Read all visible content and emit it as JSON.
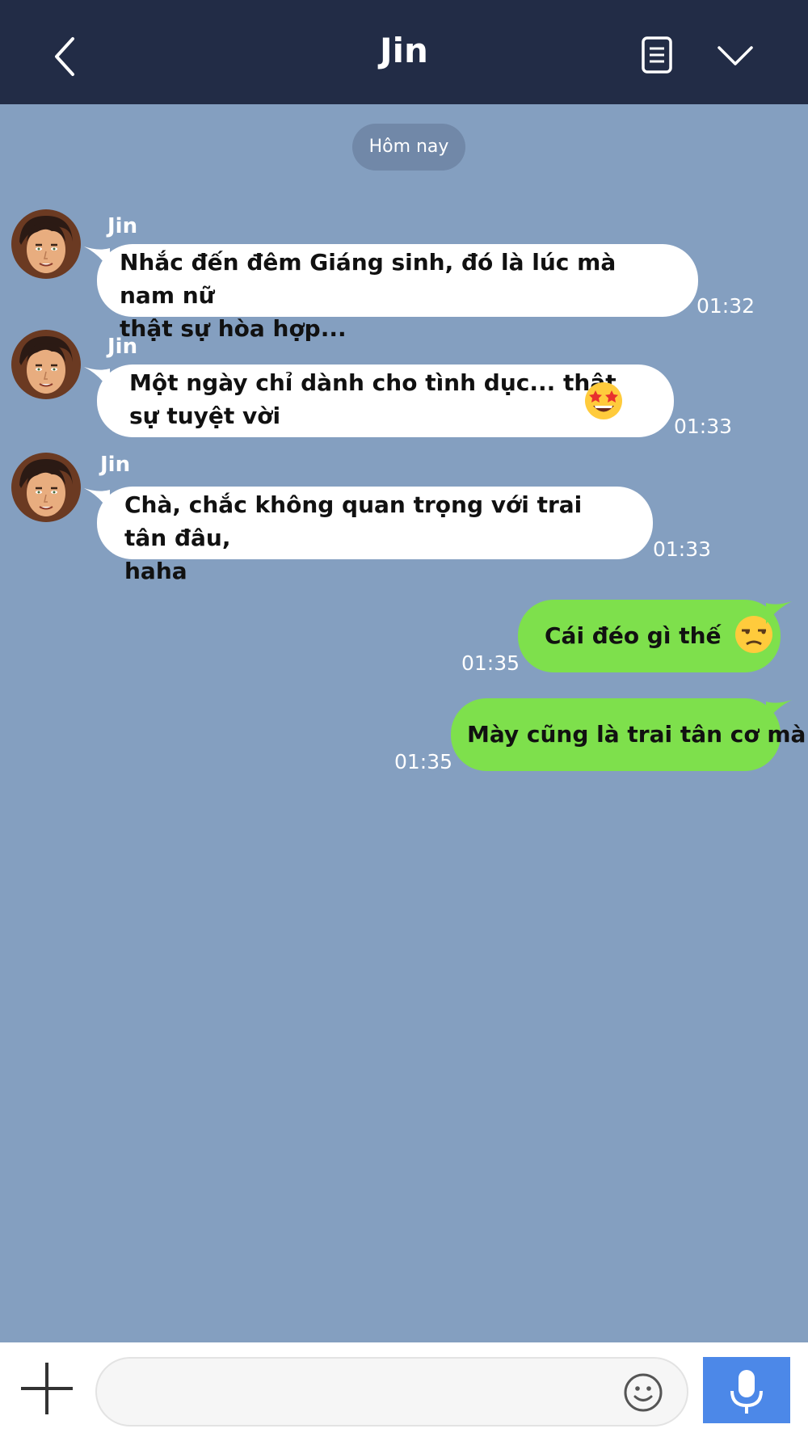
{
  "header": {
    "title": "Jin",
    "back_icon": "chevron-left-icon",
    "notes_icon": "notes-icon",
    "menu_icon": "chevron-down-icon",
    "background_color": "#222c46"
  },
  "chat": {
    "background_color": "#849fc0",
    "date_separator": "Hôm nay",
    "messages": [
      {
        "direction": "incoming",
        "sender": "Jin",
        "lines": [
          "Nhắc đến đêm Giáng sinh, đó là lúc mà nam nữ",
          "thật sự hòa hợp..."
        ],
        "time": "01:32"
      },
      {
        "direction": "incoming",
        "sender": "Jin",
        "lines": [
          "Một ngày chỉ dành cho tình dục... thật",
          "sự tuyệt vời"
        ],
        "emoji": "star-struck-emoji",
        "time": "01:33"
      },
      {
        "direction": "incoming",
        "sender": "Jin",
        "lines": [
          "Chà, chắc không quan trọng với trai tân đâu,",
          "haha"
        ],
        "time": "01:33"
      },
      {
        "direction": "outgoing",
        "text": "Cái đéo gì thế",
        "emoji": "unamused-emoji",
        "time": "01:35"
      },
      {
        "direction": "outgoing",
        "text": "Mày cũng là trai tân cơ mà",
        "time": "01:35"
      }
    ],
    "incoming_bubble_color": "#ffffff",
    "outgoing_bubble_color": "#7ee04c"
  },
  "footer": {
    "plus_icon": "plus-icon",
    "input_value": "",
    "emoji_icon": "smiley-icon",
    "mic_icon": "microphone-icon",
    "mic_button_color": "#4c88e8"
  }
}
